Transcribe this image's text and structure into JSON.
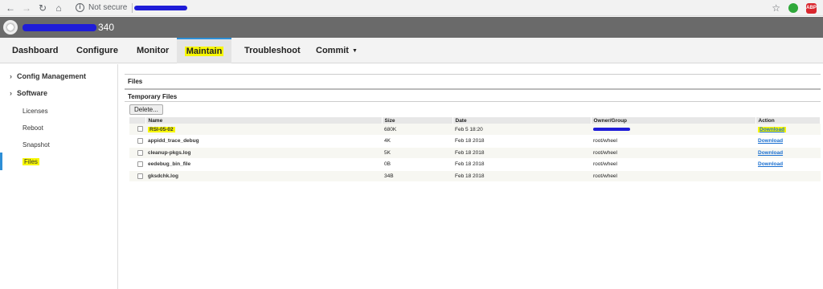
{
  "browser": {
    "security_label": "Not secure",
    "icons": {
      "back": "arrow-left-icon",
      "forward": "arrow-right-icon",
      "reload": "reload-icon",
      "home": "home-icon",
      "info": "info-icon",
      "bookmark": "star-icon"
    }
  },
  "app": {
    "host_suffix": "340"
  },
  "nav": {
    "tabs": [
      "Dashboard",
      "Configure",
      "Monitor",
      "Maintain",
      "Troubleshoot",
      "Commit"
    ],
    "active": "Maintain",
    "highlight_color": "#f7f700",
    "accent_color": "#2e8fd6"
  },
  "sidebar": {
    "groups": [
      "Config Management",
      "Software"
    ],
    "items": [
      "Licenses",
      "Reboot",
      "Snapshot",
      "Files"
    ],
    "active": "Files"
  },
  "content": {
    "section_title": "Files",
    "subsection_title": "Temporary Files",
    "delete_label": "Delete...",
    "columns": [
      "Name",
      "Size",
      "Date",
      "Owner/Group",
      "Action"
    ],
    "rows": [
      {
        "name": "RSI-05-02",
        "size": "680K",
        "date": "Feb 5 18:20",
        "owner": "",
        "action": "Download"
      },
      {
        "name": "appidd_trace_debug",
        "size": "4K",
        "date": "Feb 18 2018",
        "owner": "root/wheel",
        "action": "Download"
      },
      {
        "name": "cleanup-pkgs.log",
        "size": "5K",
        "date": "Feb 18 2018",
        "owner": "root/wheel",
        "action": "Download"
      },
      {
        "name": "eedebug_bin_file",
        "size": "0B",
        "date": "Feb 18 2018",
        "owner": "root/wheel",
        "action": "Download"
      },
      {
        "name": "gksdchk.log",
        "size": "34B",
        "date": "Feb 18 2018",
        "owner": "root/wheel",
        "action": ""
      }
    ]
  }
}
